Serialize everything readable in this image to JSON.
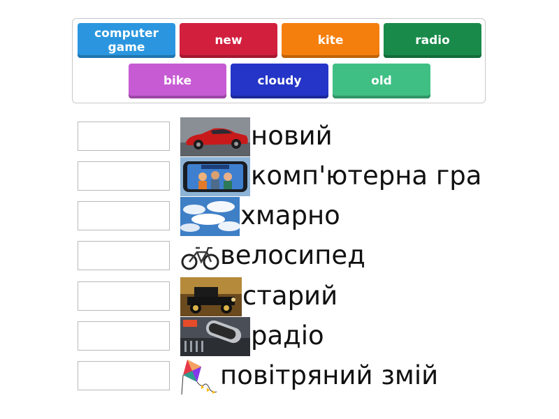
{
  "word_bank": {
    "tiles": [
      {
        "label": "computer game",
        "color": "#2b96df"
      },
      {
        "label": "new",
        "color": "#d21f3e"
      },
      {
        "label": "kite",
        "color": "#f57f0d"
      },
      {
        "label": "radio",
        "color": "#198a4a"
      },
      {
        "label": "bike",
        "color": "#c75bd3"
      },
      {
        "label": "cloudy",
        "color": "#2435c7"
      },
      {
        "label": "old",
        "color": "#3fbf84"
      }
    ]
  },
  "rows": [
    {
      "image": "red-sports-car-image",
      "label": "новий"
    },
    {
      "image": "fortnite-game-image",
      "label": "комп'ютерна гра"
    },
    {
      "image": "cloudy-sky-image",
      "label": "хмарно"
    },
    {
      "image": "bicycle-image",
      "label": "велосипед"
    },
    {
      "image": "old-car-image",
      "label": "старий"
    },
    {
      "image": "radio-microphone-image",
      "label": "радіо"
    },
    {
      "image": "kite-image",
      "label": "повітряний змій"
    }
  ]
}
